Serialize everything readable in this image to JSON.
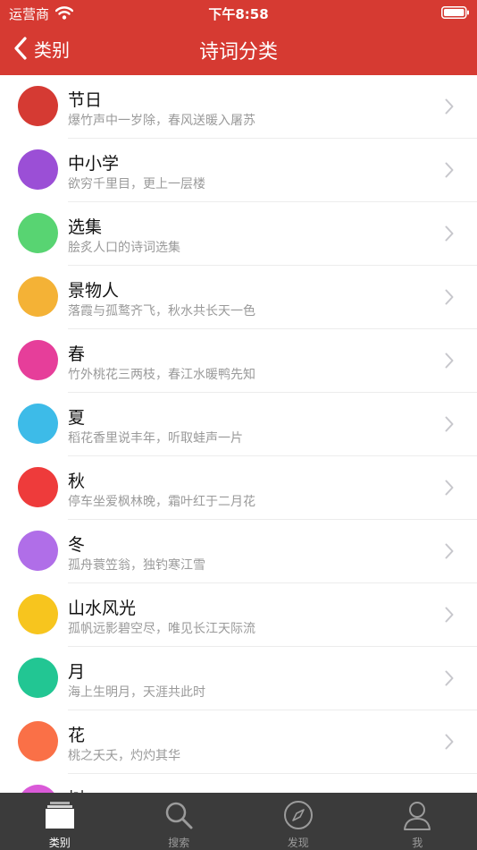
{
  "status": {
    "carrier": "运营商",
    "time": "下午8:58"
  },
  "nav": {
    "back_label": "类别",
    "title": "诗词分类"
  },
  "categories": [
    {
      "title": "节日",
      "subtitle": "爆竹声中一岁除，春风送暖入屠苏",
      "color": "#d53a33"
    },
    {
      "title": "中小学",
      "subtitle": "欲穷千里目，更上一层楼",
      "color": "#9b4fd6"
    },
    {
      "title": "选集",
      "subtitle": "脍炙人口的诗词选集",
      "color": "#58d472"
    },
    {
      "title": "景物人",
      "subtitle": "落霞与孤鹜齐飞，秋水共长天一色",
      "color": "#f4b236"
    },
    {
      "title": "春",
      "subtitle": "竹外桃花三两枝，春江水暖鸭先知",
      "color": "#e63e9a"
    },
    {
      "title": "夏",
      "subtitle": "稻花香里说丰年，听取蛙声一片",
      "color": "#3dbbe8"
    },
    {
      "title": "秋",
      "subtitle": "停车坐爱枫林晚，霜叶红于二月花",
      "color": "#ee3b3b"
    },
    {
      "title": "冬",
      "subtitle": "孤舟蓑笠翁，独钓寒江雪",
      "color": "#b06ee8"
    },
    {
      "title": "山水风光",
      "subtitle": "孤帆远影碧空尽，唯见长江天际流",
      "color": "#f7c51e"
    },
    {
      "title": "月",
      "subtitle": "海上生明月，天涯共此时",
      "color": "#22c693"
    },
    {
      "title": "花",
      "subtitle": "桃之夭夭，灼灼其华",
      "color": "#fa7047"
    },
    {
      "title": "树",
      "subtitle": "",
      "color": "#da5ad8"
    }
  ],
  "tabs": [
    {
      "label": "类别",
      "icon": "category-icon",
      "active": true
    },
    {
      "label": "搜索",
      "icon": "search-icon",
      "active": false
    },
    {
      "label": "发现",
      "icon": "compass-icon",
      "active": false
    },
    {
      "label": "我",
      "icon": "profile-icon",
      "active": false
    }
  ]
}
